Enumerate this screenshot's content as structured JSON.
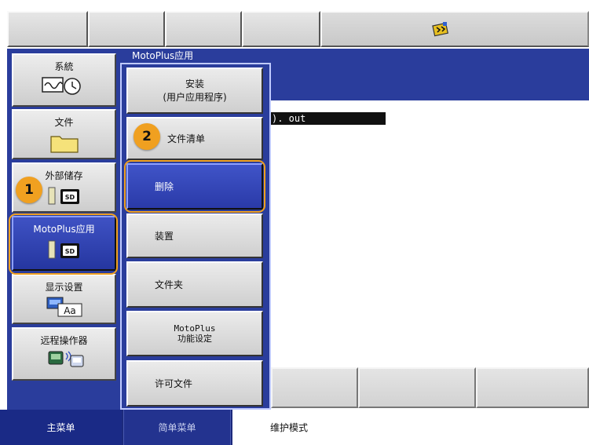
{
  "window": {
    "content_title": "MotoPlus应用"
  },
  "file_list": {
    "selected_item": "). out"
  },
  "main_menu": [
    {
      "label": "系統",
      "icon": "clock-wave-icon"
    },
    {
      "label": "文件",
      "icon": "folder-icon"
    },
    {
      "label": "外部储存",
      "icon": "sd-card-icon"
    },
    {
      "label": "MotoPlus应用",
      "icon": "sd-card-icon"
    },
    {
      "label": "显示设置",
      "icon": "display-text-icon"
    },
    {
      "label": "远程操作器",
      "icon": "remote-pendant-icon"
    }
  ],
  "submenu": [
    {
      "label_line1": "安装",
      "label_line2": "(用户应用程序)"
    },
    {
      "label": "文件清单"
    },
    {
      "label": "删除"
    },
    {
      "label": "装置"
    },
    {
      "label": "文件夹"
    },
    {
      "label_line1": "MotoPlus",
      "label_line2": "功能设定"
    },
    {
      "label": "许可文件"
    }
  ],
  "bottom_bar": {
    "tab_main": "主菜单",
    "tab_simple": "简单菜单",
    "status_mode": "维护模式"
  },
  "callouts": {
    "one": "1",
    "two": "2"
  },
  "toolbar": {
    "icon": "robot-status-icon"
  },
  "colors": {
    "frame_blue": "#2a3d9c",
    "selected_blue": "#3448b8",
    "callout_orange": "#f0a020"
  }
}
